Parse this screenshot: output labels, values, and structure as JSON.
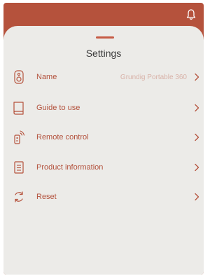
{
  "header": {
    "icon": "bell-icon"
  },
  "sheet": {
    "title": "Settings"
  },
  "colors": {
    "accent": "#b5523c",
    "sheet": "#ecebe8",
    "value": "#d8b2a8"
  },
  "items": [
    {
      "label": "Name",
      "value": "Grundig Portable 360",
      "icon": "speaker-icon"
    },
    {
      "label": "Guide to use",
      "value": "",
      "icon": "book-icon"
    },
    {
      "label": "Remote control",
      "value": "",
      "icon": "remote-icon"
    },
    {
      "label": "Product information",
      "value": "",
      "icon": "document-icon"
    },
    {
      "label": "Reset",
      "value": "",
      "icon": "reset-icon"
    }
  ]
}
